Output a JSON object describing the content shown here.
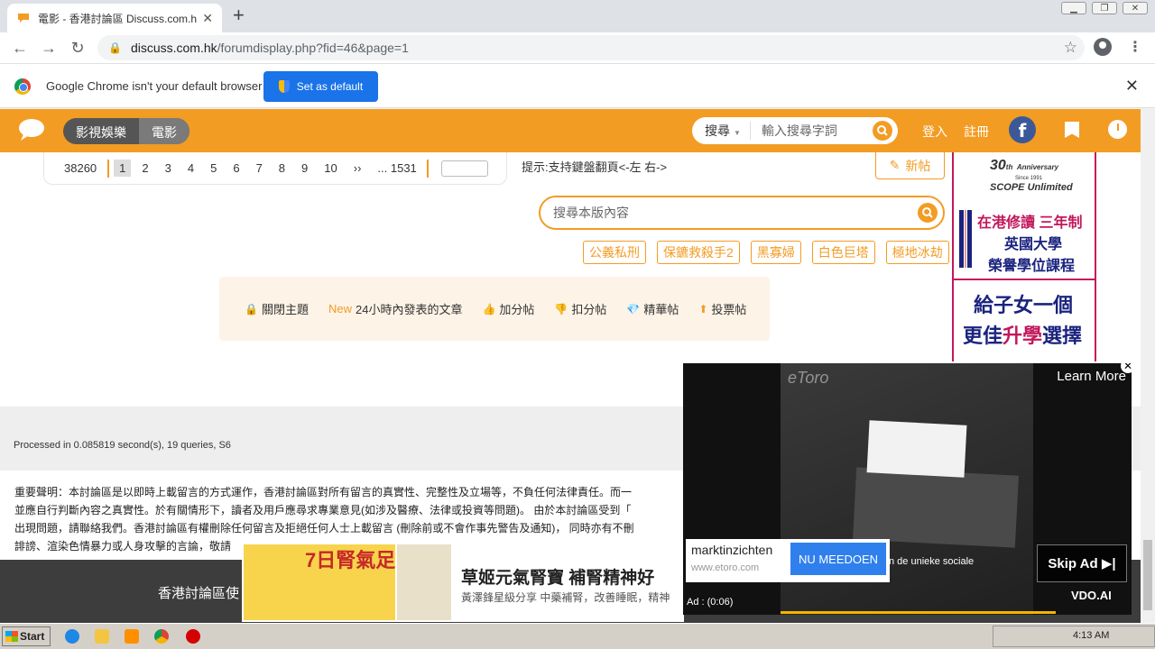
{
  "browser": {
    "tab_title": "電影 - 香港討論區 Discuss.com.hk -",
    "url_host": "discuss.com.hk",
    "url_path": "/forumdisplay.php?fid=46&page=1",
    "infobar_message": "Google Chrome isn't your default browser",
    "infobar_button": "Set as default"
  },
  "header": {
    "categories": [
      "影視娛樂",
      "電影"
    ],
    "search_type": "搜尋",
    "search_placeholder": "輸入搜尋字詞",
    "login": "登入",
    "register": "註冊",
    "facebook_letter": "f"
  },
  "pager": {
    "total": "38260",
    "pages": [
      "1",
      "2",
      "3",
      "4",
      "5",
      "6",
      "7",
      "8",
      "9",
      "10",
      "››",
      "... 1531"
    ],
    "current": "1"
  },
  "hint": "提示:支持鍵盤翻頁<-左 右->",
  "new_post": "新帖",
  "forum_search_placeholder": "搜尋本版內容",
  "tags": [
    "公義私刑",
    "保鑣救殺手2",
    "黑寡婦",
    "白色巨塔",
    "極地冰劫"
  ],
  "filters": [
    {
      "label": "關閉主題",
      "icon": "lock-icon"
    },
    {
      "prefix": "New",
      "label": "24小時內發表的文章"
    },
    {
      "label": "加分帖",
      "icon": "thumbs-up-icon"
    },
    {
      "label": "扣分帖",
      "icon": "thumbs-down-icon"
    },
    {
      "label": "精華帖",
      "icon": "gem-icon"
    },
    {
      "label": "投票帖",
      "icon": "vote-icon"
    }
  ],
  "footer": {
    "processed": "Processed in 0.085819 second(s), 19 queries, S6",
    "disclaimer_lines": [
      "重要聲明：本討論區是以即時上載留言的方式運作，香港討論區對所有留言的真實性、完整性及立場等，不負任何法律責任。而一",
      "並應自行判斷內容之真實性。於有關情形下，讀者及用戶應尋求專業意見(如涉及醫療、法律或投資等問題)。 由於本討論區受到「",
      "出現問題，請聯絡我們。香港討論區有權刪除任何留言及拒絕任何人士上載留言 (刪除前或不會作事先警告及通知)， 同時亦有不刪",
      "誹謗、渲染色情暴力或人身攻擊的言論，敬請"
    ],
    "bottom_text": "香港討論區使"
  },
  "right_ad": {
    "anniversary": "30",
    "anniversary_suffix": "th",
    "anniversary_word": "Anniversary",
    "since": "Since 1991",
    "scope": "SCOPE Unlimited",
    "line1": "在港修讀 三年制",
    "line2": "英國大學",
    "line3": "榮譽學位課程",
    "line4": "給子女一個",
    "line5a": "更佳",
    "line5b": "升學",
    "line5c": "選擇"
  },
  "video_ad": {
    "brand": "eToro",
    "learn_more": "Learn More",
    "cta_name": "marktinzichten",
    "cta_site": "www.etoro.com",
    "cta_button": "NU MEEDOEN",
    "overlay_text": "n de unieke sociale",
    "skip": "Skip Ad",
    "vendor": "VDO.AI",
    "time_label": "Ad : (0:06)"
  },
  "bottom_ad": {
    "badge": "7日腎氣足",
    "headline": "草姬元氣腎寶 補腎精神好",
    "sub": "黃澤鋒星級分享 中藥補腎，改善睡眠，精神"
  },
  "taskbar": {
    "start": "Start",
    "clock": "4:13 AM"
  }
}
